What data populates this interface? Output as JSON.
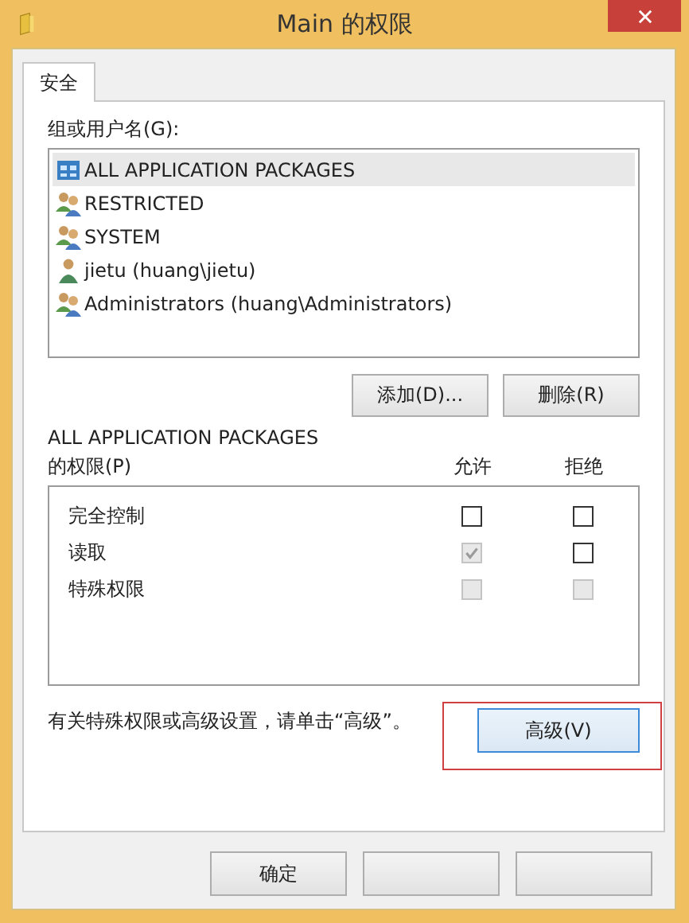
{
  "window": {
    "title": "Main 的权限"
  },
  "tabs": [
    {
      "label": "安全",
      "selected": true
    }
  ],
  "principals": {
    "label": "组或用户名(G):",
    "items": [
      {
        "name": "ALL APPLICATION PACKAGES",
        "kind": "package",
        "selected": true
      },
      {
        "name": "RESTRICTED",
        "kind": "group",
        "selected": false
      },
      {
        "name": "SYSTEM",
        "kind": "group",
        "selected": false
      },
      {
        "name": "jietu (huang\\jietu)",
        "kind": "user",
        "selected": false
      },
      {
        "name": "Administrators (huang\\Administrators)",
        "kind": "group",
        "selected": false
      }
    ]
  },
  "principal_buttons": [
    "添加(D)...",
    "删除(R)"
  ],
  "permissions": {
    "label_line_1": "ALL APPLICATION PACKAGES",
    "label_line_2": "的权限(P)",
    "allow_header": "允许",
    "deny_header": "拒绝",
    "rows": [
      {
        "name": "完全控制",
        "allow": {
          "checked": false,
          "disabled": false
        },
        "deny": {
          "checked": false,
          "disabled": false
        }
      },
      {
        "name": "读取",
        "allow": {
          "checked": true,
          "disabled": true
        },
        "deny": {
          "checked": false,
          "disabled": false
        }
      },
      {
        "name": "特殊权限",
        "allow": {
          "checked": false,
          "disabled": true
        },
        "deny": {
          "checked": false,
          "disabled": true
        }
      }
    ]
  },
  "advanced": {
    "hint": "有关特殊权限或高级设置，请单击“高级”。",
    "button": "高级(V)",
    "highlighted": true
  },
  "footer_buttons": [
    "确定"
  ]
}
